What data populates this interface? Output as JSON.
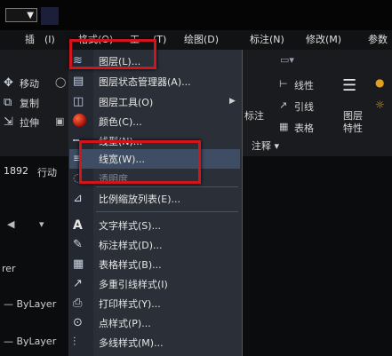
{
  "titlebar": {
    "dropdown_glyph": "▼"
  },
  "menubar": {
    "items": [
      "插",
      "(I)",
      "格式(O)",
      "工",
      "(T)",
      "绘图(D)",
      "标注(N)",
      "修改(M)",
      "参数"
    ]
  },
  "ribbon": {
    "left_tools": [
      "移动",
      "复制",
      "拉伸"
    ],
    "right_labels": [
      "线性",
      "引线",
      "表格",
      "标注",
      "图层",
      "特性",
      "注释"
    ],
    "annotation_dropdown": "注释 ▾",
    "coord_text": "1892",
    "coord_suffix": "行动"
  },
  "left_panel": {
    "layer_label": "rer",
    "bylayer_1": "— ByLayer",
    "bylayer_2": "— ByLayer"
  },
  "dropdown": {
    "items": [
      {
        "label": "图层(L)...",
        "icon": "layers-icon"
      },
      {
        "label": "图层状态管理器(A)...",
        "icon": "layer-state-icon"
      },
      {
        "label": "图层工具(O)",
        "icon": "layer-tools-icon",
        "submenu": "▶"
      },
      {
        "label": "颜色(C)...",
        "icon": "color-icon"
      },
      {
        "label": "线型(N)...",
        "icon": "linetype-icon"
      },
      {
        "label": "线宽(W)...",
        "icon": "lineweight-icon"
      },
      {
        "label": "透明度",
        "icon": "transparency-icon"
      },
      {
        "label": "比例缩放列表(E)...",
        "icon": "scale-list-icon"
      },
      {
        "label": "文字样式(S)...",
        "icon": "text-style-icon"
      },
      {
        "label": "标注样式(D)...",
        "icon": "dim-style-icon"
      },
      {
        "label": "表格样式(B)...",
        "icon": "table-style-icon"
      },
      {
        "label": "多重引线样式(I)",
        "icon": "mleader-style-icon"
      },
      {
        "label": "打印样式(Y)...",
        "icon": "plot-style-icon"
      },
      {
        "label": "点样式(P)...",
        "icon": "point-style-icon"
      },
      {
        "label": "多线样式(M)...",
        "icon": "mline-style-icon"
      }
    ]
  },
  "colors": {
    "highlight": "#3e4d64",
    "annotation_red": "#d2141c",
    "menu_bg": "#2b3038"
  }
}
